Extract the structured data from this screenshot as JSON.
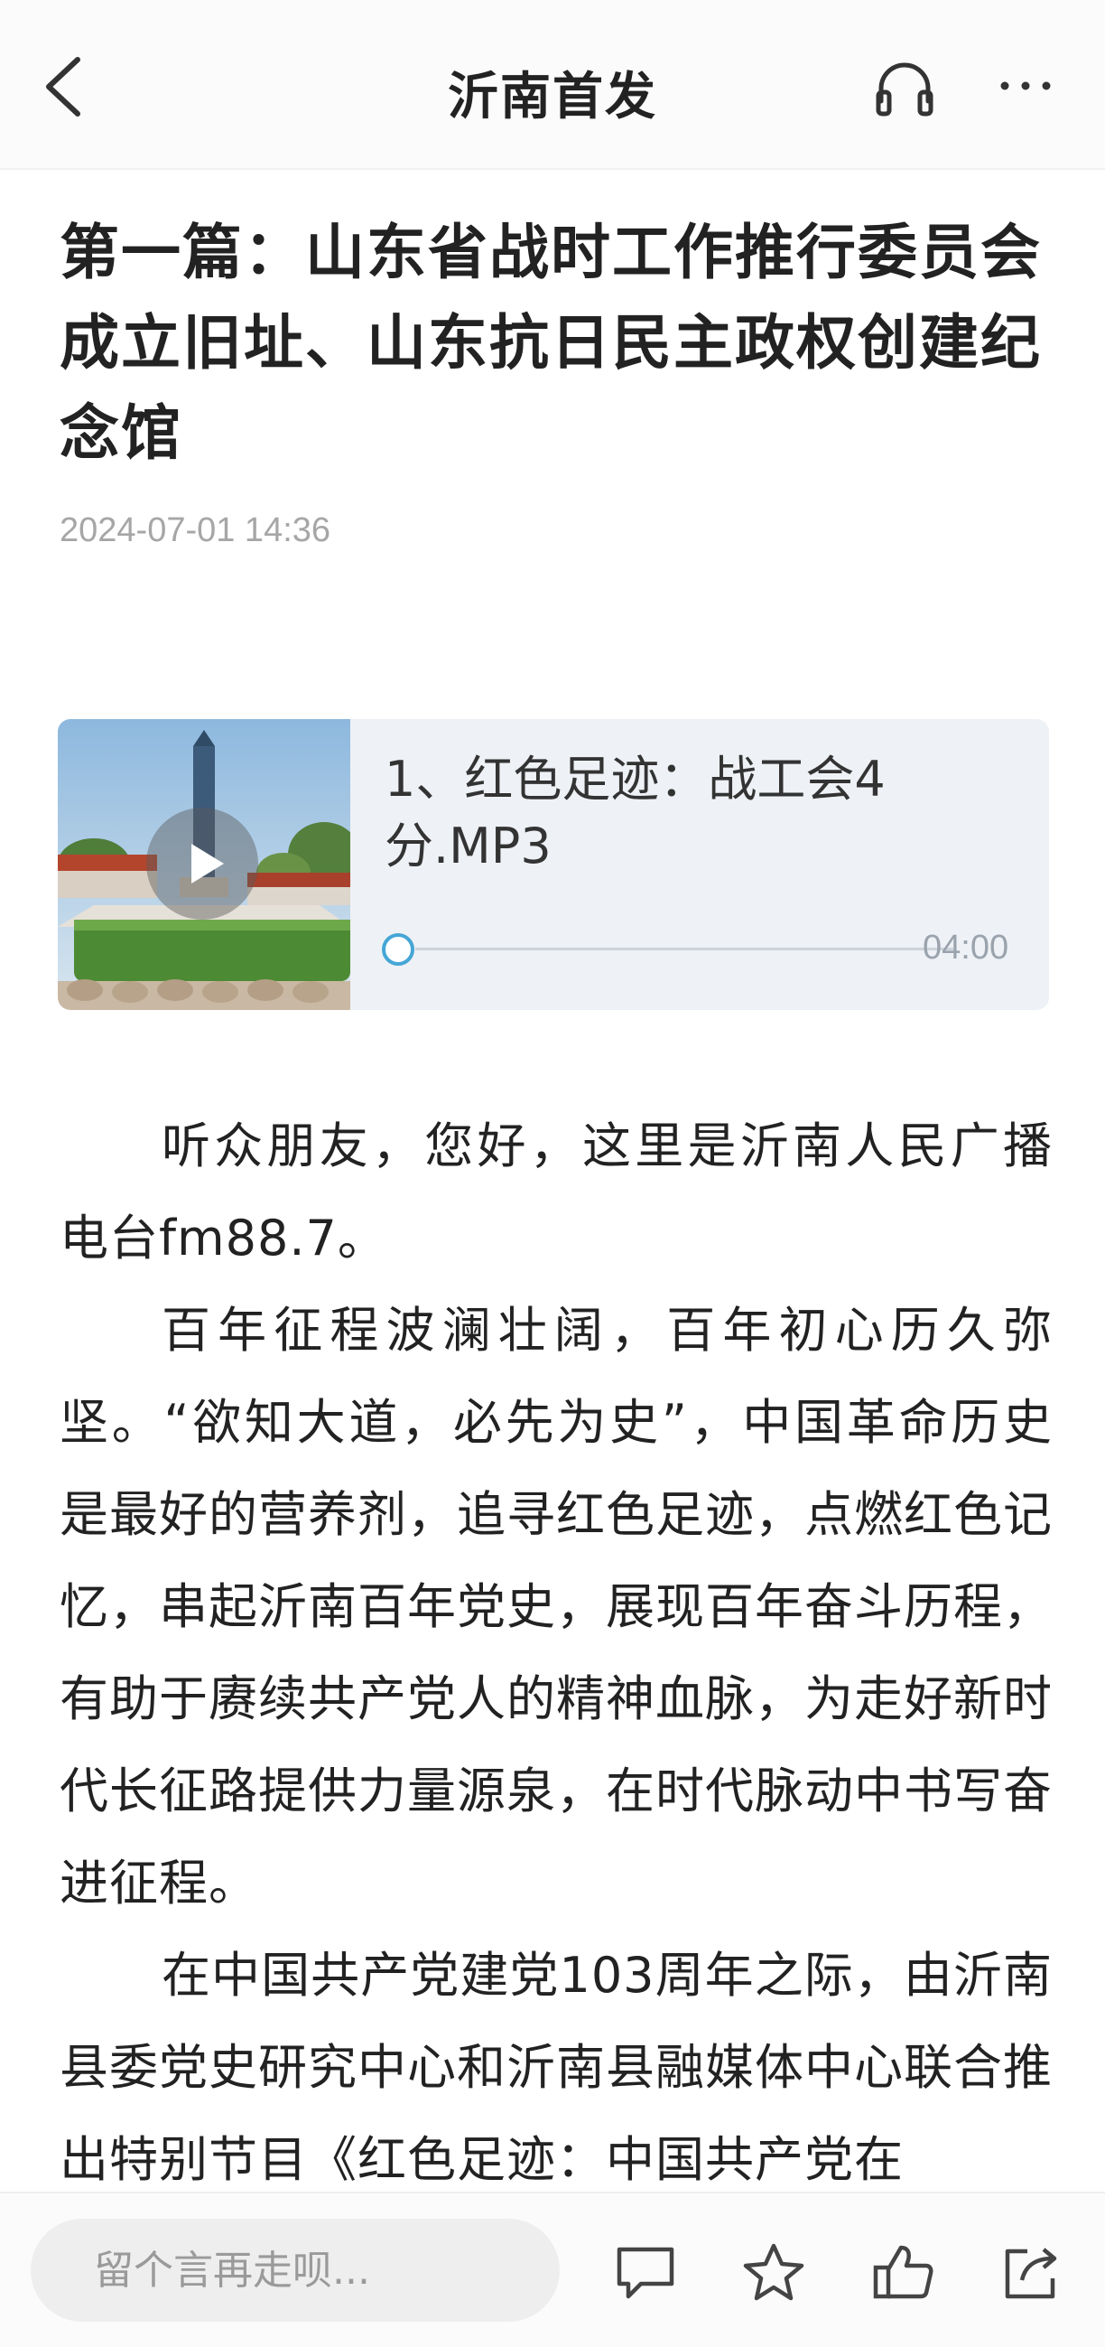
{
  "header": {
    "title": "沂南首发",
    "icons": [
      "back-icon",
      "headphones-icon",
      "more-icon"
    ]
  },
  "article": {
    "title": "第一篇：山东省战时工作推行委员会成立旧址、山东抗日民主政权创建纪念馆",
    "date": "2024-07-01 14:36"
  },
  "audio": {
    "name": "1、红色足迹：战工会4分.MP3",
    "duration": "04:00",
    "progress": 0,
    "accent_color": "#45a6d6"
  },
  "body": {
    "paragraphs": [
      "听众朋友，您好，这里是沂南人民广播电台fm88.7。",
      "百年征程波澜壮阔，百年初心历久弥坚。“欲知大道，必先为史”，中国革命历史是最好的营养剂，追寻红色足迹，点燃红色记忆，串起沂南百年党史，展现百年奋斗历程，有助于赓续共产党人的精神血脉，为走好新时代长征路提供力量源泉，在时代脉动中书写奋进征程。",
      "在中国共产党建党103周年之际，由沂南县委党史研究中心和沂南县融媒体中心联合推出特别节目《红色足迹：中国共产党在"
    ]
  },
  "bottom_bar": {
    "comment_placeholder": "留个言再走呗...",
    "icons": [
      "comment-icon",
      "star-icon",
      "thumbs-up-icon",
      "share-icon"
    ]
  }
}
